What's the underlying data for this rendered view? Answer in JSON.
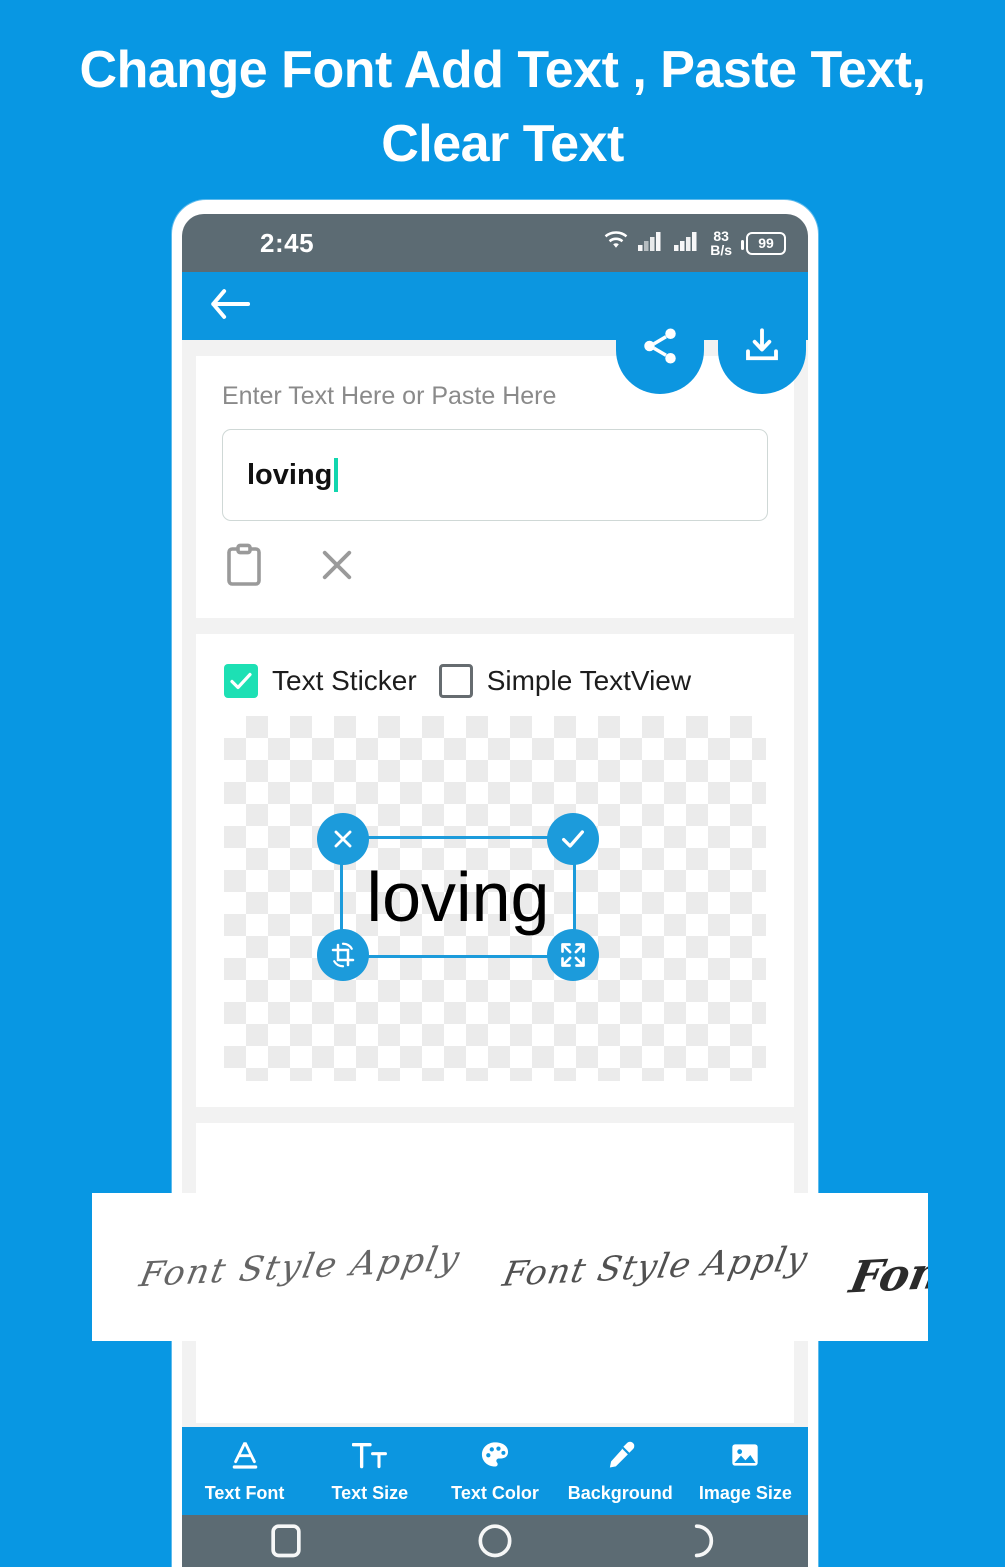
{
  "promo": {
    "headline": "Change Font Add Text , Paste Text, Clear Text",
    "background_color": "#0897E3",
    "text_color": "#FFFFFF"
  },
  "phone": {
    "status_bar": {
      "time": "2:45",
      "network_speed_value": "83",
      "network_speed_unit": "B/s",
      "battery_level": "99",
      "icons": [
        "wifi-icon",
        "signal-icon",
        "signal-icon",
        "battery-icon"
      ],
      "background_color": "#5C6B73"
    },
    "app_bar": {
      "back_icon": "back-arrow-icon",
      "share_icon": "share-icon",
      "save_icon": "download-icon",
      "background_color": "#0C96E0"
    },
    "input_card": {
      "label": "Enter Text Here or Paste Here",
      "value": "loving",
      "placeholder": "Enter Text Here or Paste Here",
      "caret_color": "#12D6AE",
      "paste_icon": "clipboard-icon",
      "clear_icon": "close-x-icon"
    },
    "mode_card": {
      "options": [
        {
          "label": "Text Sticker",
          "checked": true
        },
        {
          "label": "Simple TextView",
          "checked": false
        }
      ],
      "checked_color": "#1DE0B4"
    },
    "canvas": {
      "sticker_text": "loving",
      "selection_color": "#1C9BDB",
      "handles": [
        {
          "position": "top-left",
          "icon": "close-x-icon"
        },
        {
          "position": "top-right",
          "icon": "check-icon"
        },
        {
          "position": "bottom-left",
          "icon": "rotate-crop-icon"
        },
        {
          "position": "bottom-right",
          "icon": "resize-arrows-icon"
        }
      ]
    },
    "toolbar": {
      "items": [
        {
          "label": "Text Font",
          "icon": "underlined-a-icon"
        },
        {
          "label": "Text Size",
          "icon": "text-size-icon"
        },
        {
          "label": "Text Color",
          "icon": "palette-icon"
        },
        {
          "label": "Background",
          "icon": "eyedropper-icon"
        },
        {
          "label": "Image Size",
          "icon": "image-icon"
        }
      ],
      "background_color": "#0C96E0"
    },
    "nav_bar": {
      "items": [
        "recents-nav-icon",
        "home-nav-icon",
        "back-nav-icon"
      ],
      "background_color": "#5C6B73"
    }
  },
  "font_band": {
    "samples": [
      {
        "text": "Font Style Apply"
      },
      {
        "text": "Font Style Apply"
      },
      {
        "text": "Font Style Apply"
      }
    ]
  }
}
